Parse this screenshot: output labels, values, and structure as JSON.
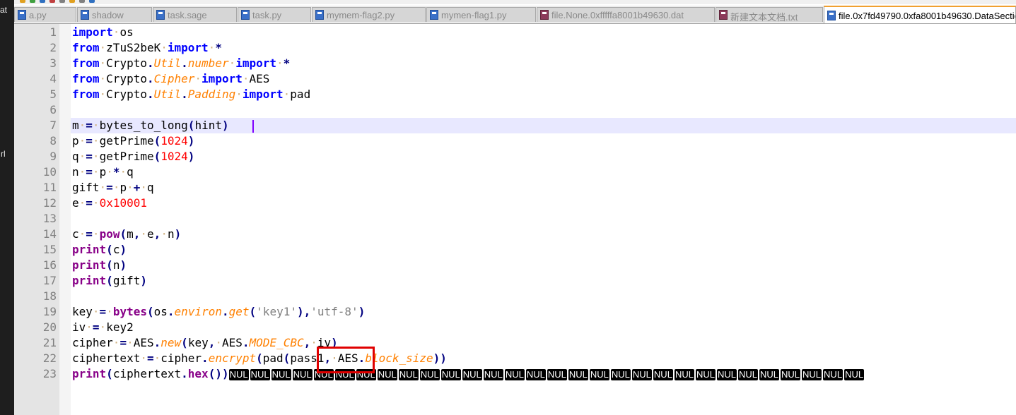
{
  "left_strip": {
    "top_text": "at",
    "mid_text": "rl"
  },
  "tabs": [
    {
      "label": "a.py",
      "active": false
    },
    {
      "label": "shadow",
      "active": false
    },
    {
      "label": "task.sage",
      "active": false
    },
    {
      "label": "task.py",
      "active": false
    },
    {
      "label": "mymem-flag2.py",
      "active": false
    },
    {
      "label": "mymen-flag1.py",
      "active": false
    },
    {
      "label": "file.None.0xfffffa8001b49630.dat",
      "active": false
    },
    {
      "label": "新建文本文档.txt",
      "active": false
    },
    {
      "label": "file.0x7fd49790.0xfa8001b49630.DataSectio",
      "active": true
    }
  ],
  "editor": {
    "line_numbers": [
      "1",
      "2",
      "3",
      "4",
      "5",
      "6",
      "7",
      "8",
      "9",
      "10",
      "11",
      "12",
      "13",
      "14",
      "15",
      "16",
      "17",
      "18",
      "19",
      "20",
      "21",
      "22",
      "23"
    ],
    "lines": [
      "import os",
      "from zTuS2beK import *",
      "from Crypto.Util.number import *",
      "from Crypto.Cipher import AES",
      "from Crypto.Util.Padding import pad",
      "",
      "m = bytes_to_long(hint)",
      "p = getPrime(1024)",
      "q = getPrime(1024)",
      "n = p * q",
      "gift = p + q",
      "e = 0x10001",
      "",
      "c = pow(m, e, n)",
      "print(c)",
      "print(n)",
      "print(gift)",
      "",
      "key = bytes(os.environ.get('key1'),'utf-8')",
      "iv = key2",
      "cipher = AES.new(key, AES.MODE_CBC, iv)",
      "ciphertext = cipher.encrypt(pad(pass1, AES.block_size))",
      "print(ciphertext.hex())"
    ],
    "nul_label": "NUL",
    "nul_count": 30,
    "current_line": "7",
    "highlighted_token": "(pass1,"
  },
  "colors": {
    "keyword": "#0000ff",
    "builtin": "#880088",
    "attribute": "#ff8000",
    "number": "#ff0000",
    "string": "#808080",
    "current_line_bg": "#e8e8ff",
    "annotation_box": "#e00000",
    "active_tab_accent": "#f0a030"
  },
  "icons": [
    "file-icon",
    "fold-margin",
    "caret"
  ]
}
